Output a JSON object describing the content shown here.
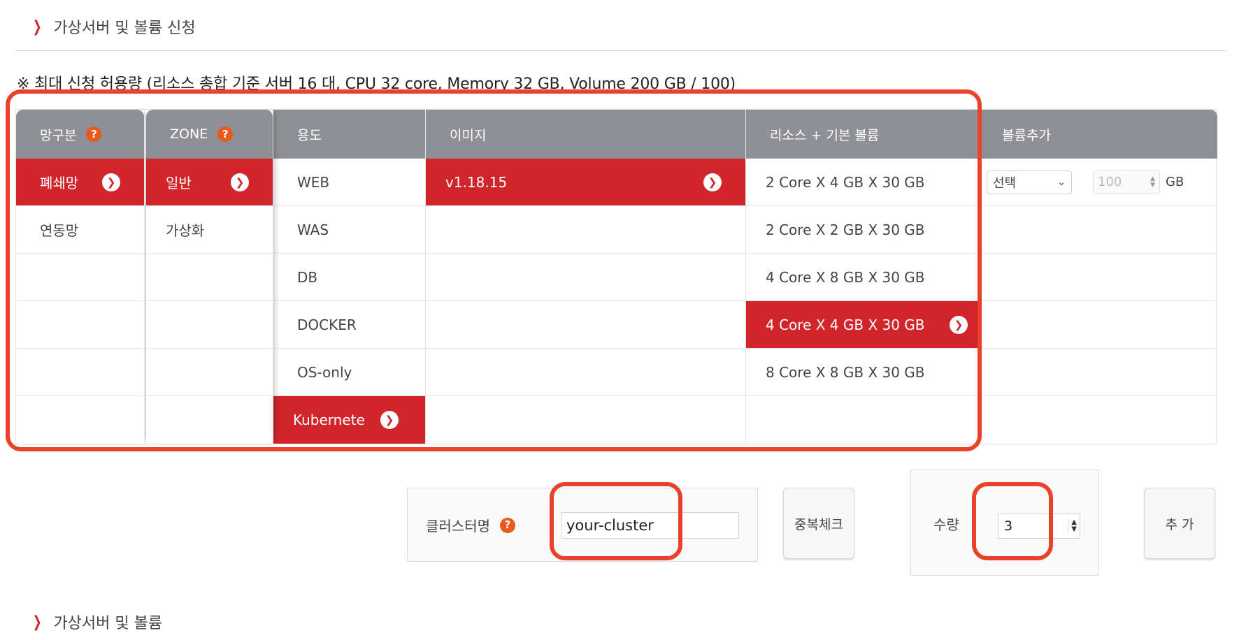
{
  "sections": {
    "top": "가상서버 및 볼륨 신청",
    "bottom": "가상서버 및 볼륨"
  },
  "notice": "※ 최대 신청 허용량 (리소스 총합 기준 서버 16 대, CPU 32 core, Memory 32 GB, Volume 200 GB / 100)",
  "columns": {
    "network": {
      "header": "망구분",
      "items": [
        "폐쇄망",
        "연동망"
      ],
      "selected": "폐쇄망"
    },
    "zone": {
      "header": "ZONE",
      "items": [
        "일반",
        "가상화"
      ],
      "selected": "일반"
    },
    "purpose": {
      "header": "용도",
      "items": [
        "WEB",
        "WAS",
        "DB",
        "DOCKER",
        "OS-only",
        "Kubernetes"
      ],
      "selected": "Kubernetes",
      "selected_display": "Kubernete"
    },
    "image": {
      "header": "이미지",
      "items": [
        "v1.18.15"
      ],
      "selected": "v1.18.15"
    },
    "resource": {
      "header": "리소스 + 기본 볼륨",
      "items": [
        "2 Core X 4 GB X 30 GB",
        "2 Core X 2 GB X 30 GB",
        "4 Core X 8 GB X 30 GB",
        "4 Core X 4 GB X 30 GB",
        "8 Core X 8 GB X 30 GB"
      ],
      "selected": "4 Core X 4 GB X 30 GB"
    },
    "volume": {
      "header": "볼륨추가",
      "select_value": "선택",
      "size_placeholder": "100",
      "unit": "GB"
    }
  },
  "cluster": {
    "label": "클러스터명",
    "value": "your-cluster",
    "dup_check_label": "중복체크"
  },
  "quantity": {
    "label": "수량",
    "value": "3"
  },
  "add_button_label": "추 가",
  "colors": {
    "accent_red": "#d0262b",
    "header_gray": "#8f9095",
    "help_orange": "#e85a1e",
    "highlight_box": "#e8432a"
  }
}
